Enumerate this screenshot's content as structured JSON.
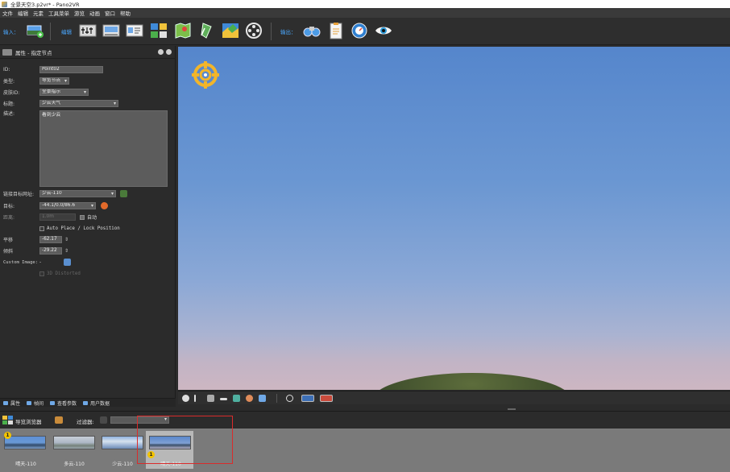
{
  "titlebar": {
    "title": "全景天空3.p2vr* - Pano2VR"
  },
  "menu": {
    "items": [
      "文件",
      "编辑",
      "元素",
      "工具菜单",
      "游览",
      "动画",
      "窗口",
      "帮助"
    ]
  },
  "toolbar": {
    "input_label": "输入：",
    "edit_label": "编辑",
    "output_label": "输出：",
    "input_buttons": [
      "add-panorama-icon"
    ],
    "edit_buttons": [
      "properties-icon",
      "viewing-params-icon",
      "user-data-icon",
      "patches-icon",
      "map-icon",
      "edit-tour-icon",
      "skin-editor-icon",
      "animation-icon"
    ],
    "output_buttons": [
      "binoculars-icon",
      "clipboard-icon",
      "preview-icon",
      "eye-icon"
    ]
  },
  "properties": {
    "header": "属性 - 指定节点",
    "id_label": "ID:",
    "id_value": "Point02",
    "type_label": "类型:",
    "type_value": "导览节点",
    "skin_id_label": "皮肤ID:",
    "skin_id_value": "全景指示",
    "title_label": "标题:",
    "title_value": "少云天气",
    "desc_label": "描述:",
    "desc_value": "看到少云",
    "link_target_label": "链接目标网址:",
    "link_target_value": "少云-110",
    "target_label": "目标:",
    "target_value": "-44.1/0.0/86.6",
    "distance_label": "距离:",
    "distance_value": "1.0m",
    "auto_label": "自动",
    "auto_place_label": "Auto Place / Lock Position",
    "pan_label": "平移",
    "pan_value": "-62.17",
    "tilt_label": "倾斜",
    "tilt_value": "-29.22",
    "custom_image_label": "Custom Image:",
    "custom_image_value": "-",
    "distorted_label": "3D Distorted"
  },
  "left_tabs": [
    "属性",
    "帧间",
    "查看参数",
    "用户数据"
  ],
  "tour_browser": {
    "title": "导览浏览器",
    "filter_label": "过滤器:",
    "thumbnails": [
      {
        "label": "晴天-110",
        "badge": "1"
      },
      {
        "label": "多云-110",
        "badge": ""
      },
      {
        "label": "少云-110",
        "badge": ""
      },
      {
        "label": "晴天-110",
        "badge": "1"
      }
    ]
  },
  "colors": {
    "accent_blue": "#4aa8ff",
    "selection_red": "#d92c2c",
    "sky_top": "#5586cc",
    "sky_horizon": "#cdb6c2",
    "badge_yellow": "#f3c300"
  }
}
